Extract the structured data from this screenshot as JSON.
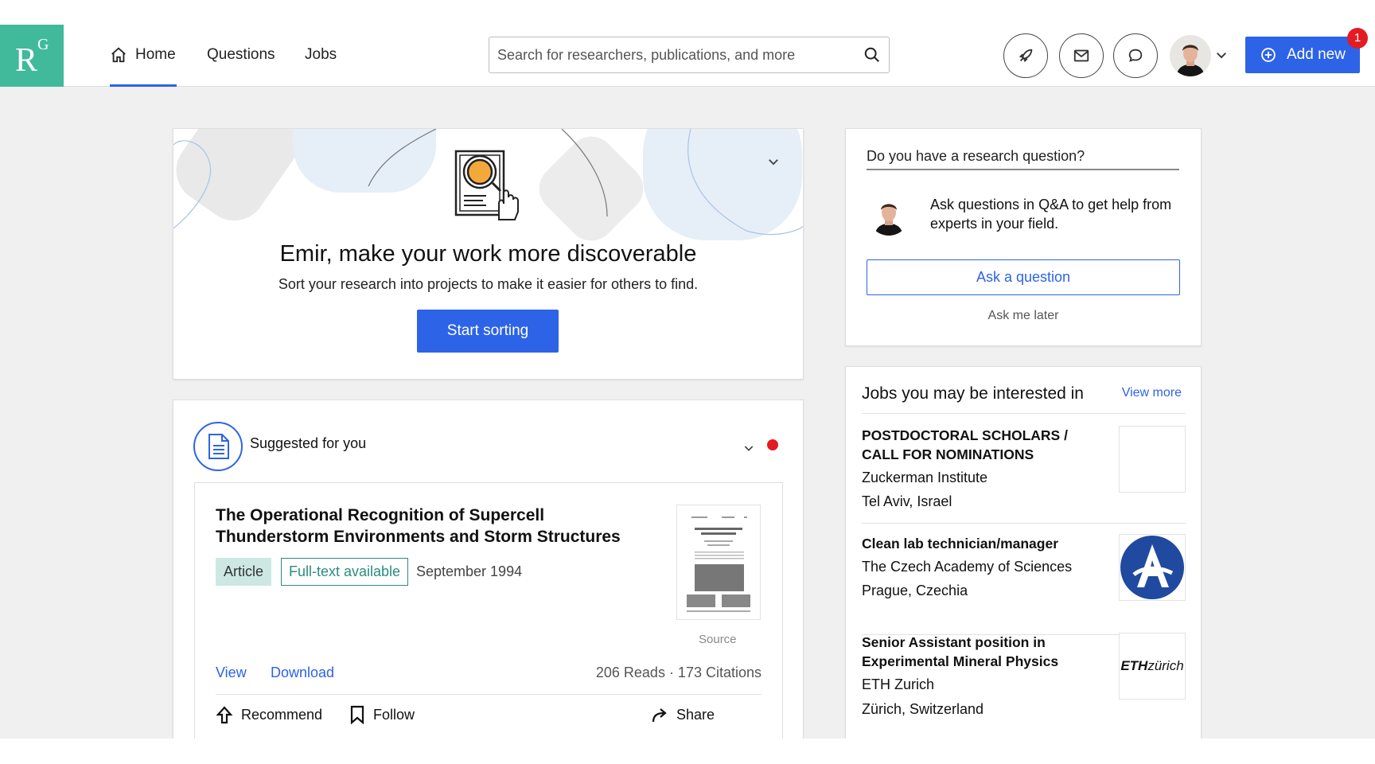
{
  "header": {
    "logo_text": "R",
    "logo_sup": "G",
    "nav": {
      "home": "Home",
      "questions": "Questions",
      "jobs": "Jobs"
    },
    "search_placeholder": "Search for researchers, publications, and more",
    "add_new_label": "Add new",
    "notification_count": "1",
    "icons": [
      "rocket-icon",
      "mail-icon",
      "chat-bubble-icon",
      "search-icon",
      "plus-circle-icon",
      "chevron-down-icon"
    ]
  },
  "promo": {
    "title": "Emir, make your work more discoverable",
    "subtitle": "Sort your research into projects to make it easier for others to find.",
    "button": "Start sorting"
  },
  "suggested": {
    "heading": "Suggested for you",
    "publication": {
      "title": "The Operational Recognition of Supercell Thunderstorm Environments and Storm Structures",
      "type": "Article",
      "availability": "Full-text available",
      "date": "September 1994",
      "source_label": "Source",
      "view": "View",
      "download": "Download",
      "stats": "206 Reads · 173 Citations",
      "recommend": "Recommend",
      "follow": "Follow",
      "share": "Share"
    }
  },
  "question_card": {
    "title": "Do you have a research question?",
    "text": "Ask questions in Q&A to get help from experts in your field.",
    "button": "Ask a question",
    "later": "Ask me later"
  },
  "jobs": {
    "title": "Jobs you may be interested in",
    "view_more": "View more",
    "items": [
      {
        "title": "POSTDOCTORAL SCHOLARS / CALL FOR NOMINATIONS",
        "org": "Zuckerman Institute",
        "location": "Tel Aviv, Israel"
      },
      {
        "title": "Clean lab technician/manager",
        "org": "The Czech Academy of Sciences",
        "location": "Prague, Czechia"
      },
      {
        "title": "Senior Assistant position in Experimental Mineral Physics",
        "org": "ETH Zurich",
        "location": "Zürich, Switzerland",
        "logo_text_bold": "ETH",
        "logo_text": "zürich"
      }
    ]
  },
  "colors": {
    "brand_green": "#40ba9b",
    "primary_blue": "#2d63e6",
    "alert_red": "#e31b23",
    "tag_teal": "#2b8c80"
  }
}
